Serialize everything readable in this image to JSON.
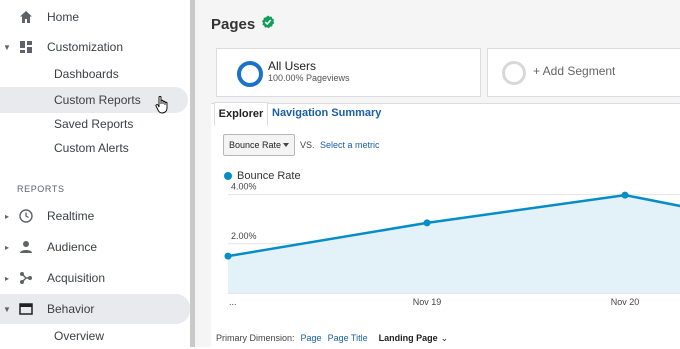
{
  "sidebar": {
    "home": "Home",
    "customization": "Customization",
    "sub_items": [
      "Dashboards",
      "Custom Reports",
      "Saved Reports",
      "Custom Alerts"
    ],
    "section_header": "REPORTS",
    "reports": [
      "Realtime",
      "Audience",
      "Acquisition",
      "Behavior"
    ],
    "behavior_sub": "Overview"
  },
  "header": {
    "title": "Pages"
  },
  "segments": {
    "all_users": {
      "name": "All Users",
      "sub": "100.00% Pageviews"
    },
    "add": "+ Add Segment"
  },
  "tabs": [
    "Explorer",
    "Navigation Summary"
  ],
  "controls": {
    "metric": "Bounce Rate",
    "vs": "VS.",
    "select_metric": "Select a metric"
  },
  "chart_data": {
    "type": "line",
    "series": [
      {
        "name": "Bounce Rate",
        "values": [
          1.5,
          2.85,
          3.98,
          3.5
        ]
      }
    ],
    "y_ticks": [
      "4.00%",
      "2.00%"
    ],
    "x_ticks": [
      "...",
      "Nov 19",
      "Nov 20"
    ],
    "ylim": [
      0,
      5
    ],
    "color": "#058dc7",
    "fill": "#e3f1f8"
  },
  "primary_dimension": {
    "label": "Primary Dimension:",
    "options": [
      "Page",
      "Page Title",
      "Landing Page"
    ]
  },
  "colors": {
    "accent": "#1a73c8",
    "link": "#1a5fa8",
    "verified": "#0f9d58"
  }
}
